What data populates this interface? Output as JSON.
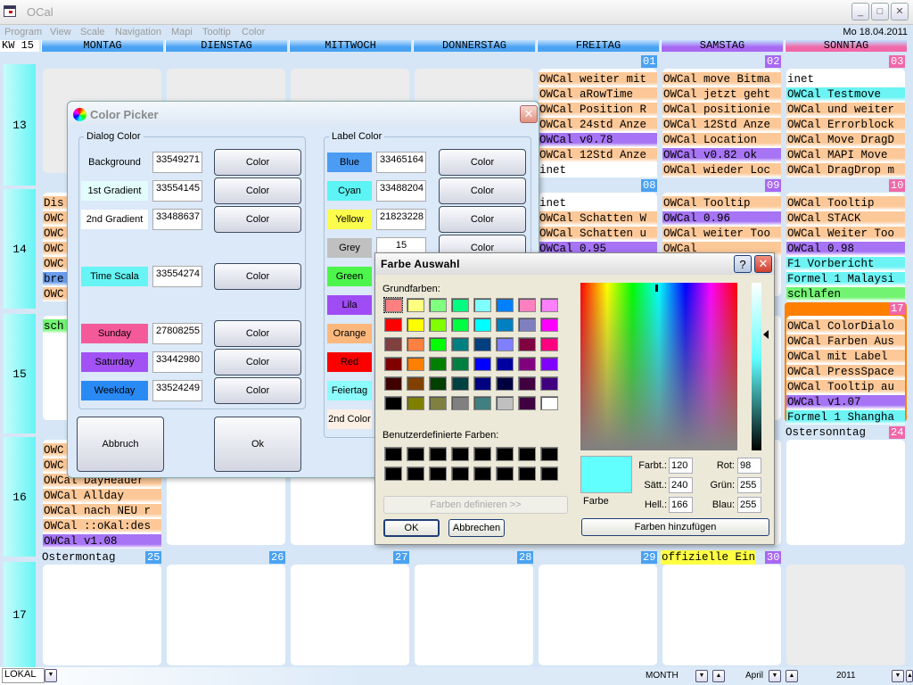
{
  "window": {
    "title": "OCal",
    "date": "Mo 18.04.2011",
    "minimize": "_",
    "maximize": "□",
    "close": "✕"
  },
  "menu": [
    "Program",
    "View",
    "Scale",
    "Navigation",
    "Mapi",
    "Tooltip",
    "Color"
  ],
  "calendar": {
    "week_label": "KW 15",
    "days": [
      {
        "name": "MONTAG",
        "color": "#4aa2f2"
      },
      {
        "name": "DIENSTAG",
        "color": "#4aa2f2"
      },
      {
        "name": "MITTWOCH",
        "color": "#4aa2f2"
      },
      {
        "name": "DONNERSTAG",
        "color": "#4aa2f2"
      },
      {
        "name": "FREITAG",
        "color": "#4aa2f2"
      },
      {
        "name": "SAMSTAG",
        "color": "#a868f2"
      },
      {
        "name": "SONNTAG",
        "color": "#f068a8"
      }
    ],
    "weeks": [
      "13",
      "14",
      "15",
      "16",
      "17"
    ],
    "event_colors": {
      "orange": "#fcc898",
      "lila": "#a674f4",
      "cyan": "#6cf4f4",
      "green": "#72f472",
      "blue": "#6a9cec",
      "yellow": "#ffff44",
      "none": "#ffffff"
    },
    "cells": [
      {
        "week": 0,
        "day": 0,
        "other_month": true
      },
      {
        "week": 0,
        "day": 1,
        "other_month": true
      },
      {
        "week": 0,
        "day": 2,
        "other_month": true
      },
      {
        "week": 0,
        "day": 3,
        "other_month": true
      },
      {
        "week": 0,
        "day": 4,
        "date": "01",
        "events": [
          {
            "t": "OWCal weiter mit",
            "c": "orange"
          },
          {
            "t": "OWCal aRowTime",
            "c": "orange"
          },
          {
            "t": "OWCal Position R",
            "c": "orange"
          },
          {
            "t": "OWCal 24std Anze",
            "c": "orange"
          },
          {
            "t": "OWCal v0.78",
            "c": "lila"
          },
          {
            "t": "OWCal 12Std Anze",
            "c": "orange"
          },
          {
            "t": "inet",
            "c": "none"
          }
        ]
      },
      {
        "week": 0,
        "day": 5,
        "date": "02",
        "events": [
          {
            "t": "OWCal move Bitma",
            "c": "orange"
          },
          {
            "t": "OWCal jetzt geht",
            "c": "orange"
          },
          {
            "t": "OWCal positionie",
            "c": "orange"
          },
          {
            "t": "OWCal 12Std Anze",
            "c": "orange"
          },
          {
            "t": "OWCal Location",
            "c": "orange"
          },
          {
            "t": "OWCal v0.82 ok",
            "c": "lila"
          },
          {
            "t": "OWCal wieder Loc",
            "c": "orange"
          }
        ]
      },
      {
        "week": 0,
        "day": 6,
        "date": "03",
        "events": [
          {
            "t": "inet",
            "c": "none"
          },
          {
            "t": "OWCal Testmove",
            "c": "cyan"
          },
          {
            "t": "OWCal und weiter",
            "c": "orange"
          },
          {
            "t": "OWCal Errorblock",
            "c": "orange"
          },
          {
            "t": "OWCal Move DragD",
            "c": "orange"
          },
          {
            "t": "OWCal MAPI Move",
            "c": "orange"
          },
          {
            "t": "OWCal DragDrop m",
            "c": "orange"
          }
        ]
      },
      {
        "week": 1,
        "day": 0,
        "events": [
          {
            "t": "Dis",
            "c": "orange"
          },
          {
            "t": "OWC",
            "c": "orange"
          },
          {
            "t": "OWC",
            "c": "orange"
          },
          {
            "t": "OWC",
            "c": "orange"
          },
          {
            "t": "OWC",
            "c": "orange"
          },
          {
            "t": "bre",
            "c": "blue"
          },
          {
            "t": "OWC",
            "c": "orange"
          }
        ]
      },
      {
        "week": 1,
        "day": 1
      },
      {
        "week": 1,
        "day": 2
      },
      {
        "week": 1,
        "day": 3
      },
      {
        "week": 1,
        "day": 4,
        "date": "08",
        "events": [
          {
            "t": "inet",
            "c": "none"
          },
          {
            "t": "OWCal Schatten W",
            "c": "orange"
          },
          {
            "t": "OWCal Schatten u",
            "c": "orange"
          },
          {
            "t": "OWCal 0.95",
            "c": "lila"
          }
        ]
      },
      {
        "week": 1,
        "day": 5,
        "date": "09",
        "events": [
          {
            "t": "OWCal Tooltip",
            "c": "orange"
          },
          {
            "t": "OWCal 0.96",
            "c": "lila"
          },
          {
            "t": "OWCal weiter Too",
            "c": "orange"
          },
          {
            "t": "OWCal",
            "c": "orange"
          }
        ]
      },
      {
        "week": 1,
        "day": 6,
        "date": "10",
        "events": [
          {
            "t": "OWCal Tooltip",
            "c": "orange"
          },
          {
            "t": "OWCal STACK",
            "c": "orange"
          },
          {
            "t": "OWCal Weiter Too",
            "c": "orange"
          },
          {
            "t": "OWCal 0.98",
            "c": "lila"
          },
          {
            "t": "F1 Vorbericht",
            "c": "cyan"
          },
          {
            "t": "Formel 1 Malaysi",
            "c": "cyan"
          },
          {
            "t": "schlafen",
            "c": "green"
          }
        ]
      },
      {
        "week": 2,
        "day": 0,
        "events": [
          {
            "t": "sch",
            "c": "green"
          }
        ]
      },
      {
        "week": 2,
        "day": 1
      },
      {
        "week": 2,
        "day": 2
      },
      {
        "week": 2,
        "day": 3
      },
      {
        "week": 2,
        "day": 4
      },
      {
        "week": 2,
        "day": 5
      },
      {
        "week": 2,
        "day": 6,
        "date": "17",
        "today": true,
        "events": [
          {
            "t": "OWCal ColorDialo",
            "c": "orange"
          },
          {
            "t": "OWCal Farben Aus",
            "c": "orange"
          },
          {
            "t": "OWCal mit Label",
            "c": "orange"
          },
          {
            "t": "OWCal PressSpace",
            "c": "orange"
          },
          {
            "t": "OWCal Tooltip au",
            "c": "orange"
          },
          {
            "t": "OWCal v1.07",
            "c": "lila"
          },
          {
            "t": "Formel 1 Shangha",
            "c": "cyan"
          }
        ]
      },
      {
        "week": 3,
        "day": 0,
        "events": [
          {
            "t": "OWC",
            "c": "orange"
          },
          {
            "t": "OWC",
            "c": "orange"
          },
          {
            "t": "OWCal DayHeader",
            "c": "orange"
          },
          {
            "t": "OWCal Allday",
            "c": "orange"
          },
          {
            "t": "OWCal nach NEU r",
            "c": "orange"
          },
          {
            "t": "OWCal ::oKal:des",
            "c": "orange"
          },
          {
            "t": "OWCal v1.08",
            "c": "lila"
          }
        ]
      },
      {
        "week": 3,
        "day": 1
      },
      {
        "week": 3,
        "day": 2
      },
      {
        "week": 3,
        "day": 3
      },
      {
        "week": 3,
        "day": 4
      },
      {
        "week": 3,
        "day": 5
      },
      {
        "week": 3,
        "day": 6,
        "date": "24",
        "holiday": "Ostersonntag"
      },
      {
        "week": 4,
        "day": 0,
        "date": "25",
        "holiday": "Ostermontag"
      },
      {
        "week": 4,
        "day": 1,
        "date": "26"
      },
      {
        "week": 4,
        "day": 2,
        "date": "27"
      },
      {
        "week": 4,
        "day": 3,
        "date": "28"
      },
      {
        "week": 4,
        "day": 4,
        "date": "29"
      },
      {
        "week": 4,
        "day": 5,
        "date": "30",
        "holiday": "offizielle Ein",
        "holiday_color": "yellow"
      },
      {
        "week": 4,
        "day": 6,
        "other_month": true
      }
    ]
  },
  "color_picker": {
    "title": "Color Picker",
    "dialog_group": "Dialog Color",
    "label_group": "Label Color",
    "dialog_rows": [
      {
        "label": "Background",
        "value": "33549271",
        "color": "#dbe9f8",
        "button": "Color"
      },
      {
        "label": "1st Gradient",
        "value": "33554145",
        "color": "#e2fcfc",
        "button": "Color"
      },
      {
        "label": "2nd Gradient",
        "value": "33488637",
        "color": "#fefefe",
        "button": "Color"
      },
      {
        "label": "Time Scala",
        "value": "33554274",
        "color": "#66f4f4",
        "button": "Color"
      },
      {
        "label": "Sunday",
        "value": "27808255",
        "color": "#f45a9a",
        "button": "Color"
      },
      {
        "label": "Saturday",
        "value": "33442980",
        "color": "#a252f4",
        "button": "Color"
      },
      {
        "label": "Weekday",
        "value": "33524249",
        "color": "#2a8af4",
        "button": "Color"
      }
    ],
    "label_rows": [
      {
        "label": "Blue",
        "value": "33465164",
        "color": "#4c9cf4",
        "button": "Color"
      },
      {
        "label": "Cyan",
        "value": "33488204",
        "color": "#5cf4f4",
        "button": "Color"
      },
      {
        "label": "Yellow",
        "value": "21823228",
        "color": "#fcfc4c",
        "button": "Color"
      },
      {
        "label": "Grey",
        "value": "15",
        "color": "#c0c0c0",
        "button": "Color"
      },
      {
        "label": "Green",
        "value": "",
        "color": "#4cf44c",
        "button": ""
      },
      {
        "label": "Lila",
        "value": "",
        "color": "#a04cf4",
        "button": ""
      },
      {
        "label": "Orange",
        "value": "",
        "color": "#fcb87c",
        "button": ""
      },
      {
        "label": "Red",
        "value": "",
        "color": "#fc0000",
        "button": ""
      },
      {
        "label": "Feiertag",
        "value": "",
        "color": "#8cfcfc",
        "button": ""
      },
      {
        "label": "2nd Color",
        "value": "",
        "color": "#fcf0e4",
        "button": ""
      }
    ],
    "cancel": "Abbruch",
    "ok": "Ok"
  },
  "farbe": {
    "title": "Farbe Auswahl",
    "help": "?",
    "close": "✕",
    "basic_label": "Grundfarben:",
    "basic_colors": [
      "#ff8080",
      "#ffff80",
      "#80ff80",
      "#00ff80",
      "#80ffff",
      "#0080ff",
      "#ff80c0",
      "#ff80ff",
      "#ff0000",
      "#ffff00",
      "#80ff00",
      "#00ff40",
      "#00ffff",
      "#0080c0",
      "#8080c0",
      "#ff00ff",
      "#804040",
      "#ff8040",
      "#00ff00",
      "#008080",
      "#004080",
      "#8080ff",
      "#800040",
      "#ff0080",
      "#800000",
      "#ff8000",
      "#008000",
      "#008040",
      "#0000ff",
      "#0000a0",
      "#800080",
      "#8000ff",
      "#400000",
      "#804000",
      "#004000",
      "#004040",
      "#000080",
      "#000040",
      "#400040",
      "#400080",
      "#000000",
      "#808000",
      "#808040",
      "#808080",
      "#408080",
      "#c0c0c0",
      "#400040",
      "#ffffff"
    ],
    "custom_label": "Benutzerdefinierte Farben:",
    "custom_colors": [
      "#000000",
      "#000000",
      "#000000",
      "#000000",
      "#000000",
      "#000000",
      "#000000",
      "#000000",
      "#000000",
      "#000000",
      "#000000",
      "#000000",
      "#000000",
      "#000000",
      "#000000",
      "#000000"
    ],
    "define": "Farben definieren >>",
    "ok": "OK",
    "cancel": "Abbrechen",
    "preview_label": "Farbe",
    "preview_color": "#62ffff",
    "hue_label": "Farbt.:",
    "hue": "120",
    "sat_label": "Sätt.:",
    "sat": "240",
    "lum_label": "Hell.:",
    "lum": "166",
    "red_label": "Rot:",
    "red": "98",
    "green_label": "Grün:",
    "green": "255",
    "blue_label": "Blau:",
    "blue": "255",
    "add": "Farben hinzufügen"
  },
  "statusbar": {
    "location": "LOKAL",
    "view": "MONTH",
    "month": "April",
    "year": "2011"
  }
}
